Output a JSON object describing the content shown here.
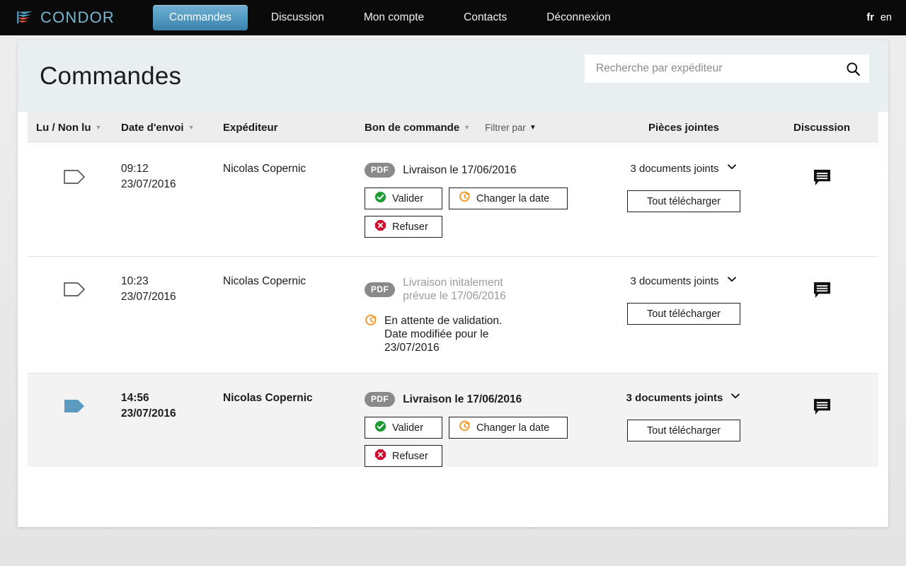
{
  "header": {
    "brand": "CONDOR",
    "brand_icon": "condor-wing-logo",
    "nav": [
      {
        "label": "Commandes",
        "active": true
      },
      {
        "label": "Discussion",
        "active": false
      },
      {
        "label": "Mon compte",
        "active": false
      },
      {
        "label": "Contacts",
        "active": false
      },
      {
        "label": "Déconnexion",
        "active": false
      }
    ],
    "languages": [
      {
        "code": "fr",
        "active": true
      },
      {
        "code": "en",
        "active": false
      }
    ]
  },
  "page": {
    "title": "Commandes",
    "search": {
      "placeholder": "Recherche par expéditeur",
      "value": "",
      "icon": "search-icon"
    }
  },
  "table": {
    "columns": {
      "read": "Lu / Non lu",
      "date": "Date d'envoi",
      "sender": "Expéditeur",
      "order": "Bon de commande",
      "filter": "Filtrer par",
      "attachments": "Pièces jointes",
      "discussion": "Discussion"
    },
    "rows": [
      {
        "unread": false,
        "read_icon": "tag-outline-icon",
        "time": "09:12",
        "date": "23/07/2016",
        "sender": "Nicolas Copernic",
        "badge": "PDF",
        "delivery_text": "Livraison le 17/06/2016",
        "delivery_muted": false,
        "status_text": "",
        "buttons": [
          {
            "label": "Valider",
            "icon": "check-circle-icon"
          },
          {
            "label": "Changer la date",
            "icon": "clock-refresh-icon"
          },
          {
            "label": "Refuser",
            "icon": "x-octagon-icon"
          }
        ],
        "attachments_label": "3 documents joints",
        "download_label": "Tout télécharger",
        "discussion_icon": "chat-bubble-icon"
      },
      {
        "unread": false,
        "read_icon": "tag-outline-icon",
        "time": "10:23",
        "date": "23/07/2016",
        "sender": "Nicolas Copernic",
        "badge": "PDF",
        "delivery_text": "Livraison initalement prévue le 17/06/2016",
        "delivery_muted": true,
        "status_text": "En attente de validation. Date modifiée pour le 23/07/2016",
        "status_icon": "clock-refresh-icon",
        "buttons": [],
        "attachments_label": "3 documents joints",
        "download_label": "Tout télécharger",
        "discussion_icon": "chat-bubble-icon"
      },
      {
        "unread": true,
        "read_icon": "tag-filled-icon",
        "time": "14:56",
        "date": "23/07/2016",
        "sender": "Nicolas Copernic",
        "badge": "PDF",
        "delivery_text": "Livraison le 17/06/2016",
        "delivery_muted": false,
        "status_text": "",
        "buttons": [
          {
            "label": "Valider",
            "icon": "check-circle-icon"
          },
          {
            "label": "Changer la date",
            "icon": "clock-refresh-icon"
          },
          {
            "label": "Refuser",
            "icon": "x-octagon-icon"
          }
        ],
        "attachments_label": "3 documents joints",
        "download_label": "Tout télécharger",
        "discussion_icon": "chat-bubble-icon"
      }
    ]
  },
  "colors": {
    "brand_blue": "#79b6cf",
    "nav_active": "#58a0c6",
    "topbar": "#0a0a0a",
    "validate_green": "#1d9c34",
    "refuse_red": "#cf0a2c",
    "clock_orange": "#f79420",
    "badge_gray": "#8a8a8a",
    "unread_tag": "#5b9bc0"
  }
}
